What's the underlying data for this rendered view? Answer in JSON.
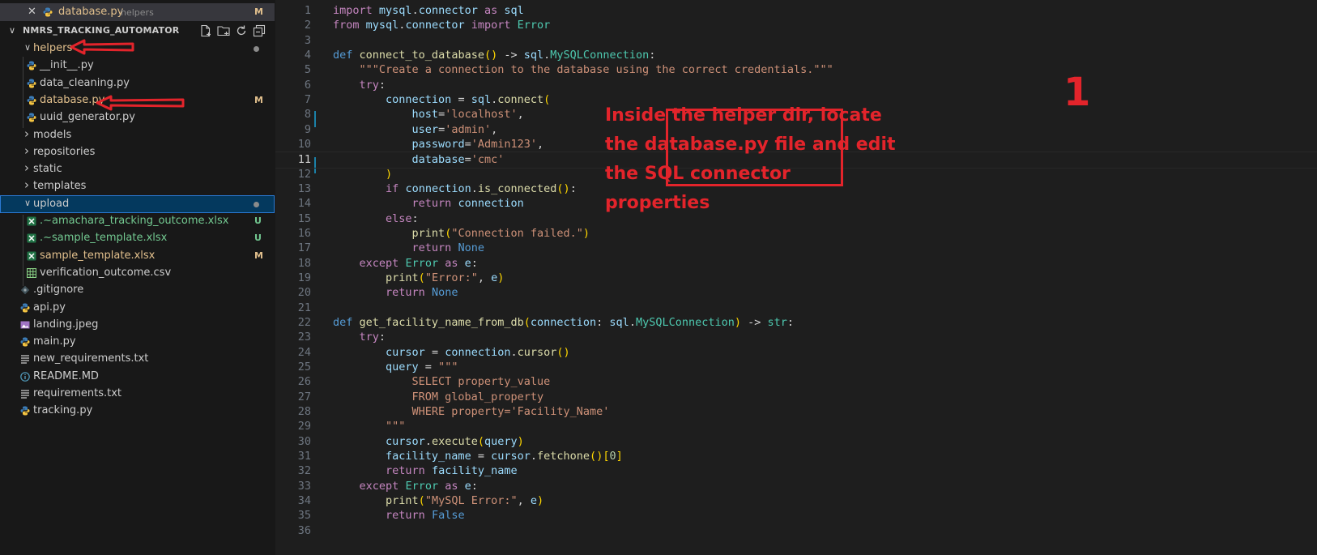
{
  "open_editor": {
    "close_glyph": "✕",
    "file_name": "database.py",
    "folder": "helpers",
    "status": "M"
  },
  "explorer": {
    "project_title": "NMRS_TRACKING_AUTOMATOR",
    "toolbar_icons": [
      "new-file-icon",
      "new-folder-icon",
      "refresh-icon",
      "collapse-all-icon"
    ],
    "items": [
      {
        "label": "helpers",
        "type": "folder-open",
        "status": "dot"
      },
      {
        "label": "__init__.py",
        "type": "python"
      },
      {
        "label": "data_cleaning.py",
        "type": "python"
      },
      {
        "label": "database.py",
        "type": "python",
        "status": "M"
      },
      {
        "label": "uuid_generator.py",
        "type": "python"
      },
      {
        "label": "models",
        "type": "folder-closed"
      },
      {
        "label": "repositories",
        "type": "folder-closed"
      },
      {
        "label": "static",
        "type": "folder-closed"
      },
      {
        "label": "templates",
        "type": "folder-closed"
      },
      {
        "label": "upload",
        "type": "folder-open",
        "status": "dot"
      },
      {
        "label": ".~amachara_tracking_outcome.xlsx",
        "type": "excel",
        "status": "U"
      },
      {
        "label": ".~sample_template.xlsx",
        "type": "excel",
        "status": "U"
      },
      {
        "label": "sample_template.xlsx",
        "type": "excel",
        "status": "M"
      },
      {
        "label": "verification_outcome.csv",
        "type": "csv"
      },
      {
        "label": ".gitignore",
        "type": "git"
      },
      {
        "label": "api.py",
        "type": "python"
      },
      {
        "label": "landing.jpeg",
        "type": "image"
      },
      {
        "label": "main.py",
        "type": "python"
      },
      {
        "label": "new_requirements.txt",
        "type": "text"
      },
      {
        "label": "README.MD",
        "type": "info"
      },
      {
        "label": "requirements.txt",
        "type": "text"
      },
      {
        "label": "tracking.py",
        "type": "python"
      }
    ]
  },
  "editor": {
    "current_line": 11,
    "lines": [
      "import mysql.connector as sql",
      "from mysql.connector import Error",
      "",
      "def connect_to_database() -> sql.MySQLConnection:",
      "    \"\"\"Create a connection to the database using the correct credentials.\"\"\"",
      "    try:",
      "        connection = sql.connect(",
      "            host='localhost',",
      "            user='admin',",
      "            password='Admin123',",
      "            database='cmc'",
      "        )",
      "        if connection.is_connected():",
      "            return connection",
      "        else:",
      "            print(\"Connection failed.\")",
      "            return None",
      "    except Error as e:",
      "        print(\"Error:\", e)",
      "        return None",
      "",
      "def get_facility_name_from_db(connection: sql.MySQLConnection) -> str:",
      "    try:",
      "        cursor = connection.cursor()",
      "        query = \"\"\"",
      "            SELECT property_value",
      "            FROM global_property",
      "            WHERE property='Facility_Name'",
      "        \"\"\"",
      "        cursor.execute(query)",
      "        facility_name = cursor.fetchone()[0]",
      "        return facility_name",
      "    except Error as e:",
      "        print(\"MySQL Error:\", e)",
      "        return False",
      ""
    ]
  },
  "annotation": {
    "text": "Inside the helper dir, locate the database.py file and edit the SQL connector properties",
    "step_number": "1",
    "color": "#e3242b"
  }
}
